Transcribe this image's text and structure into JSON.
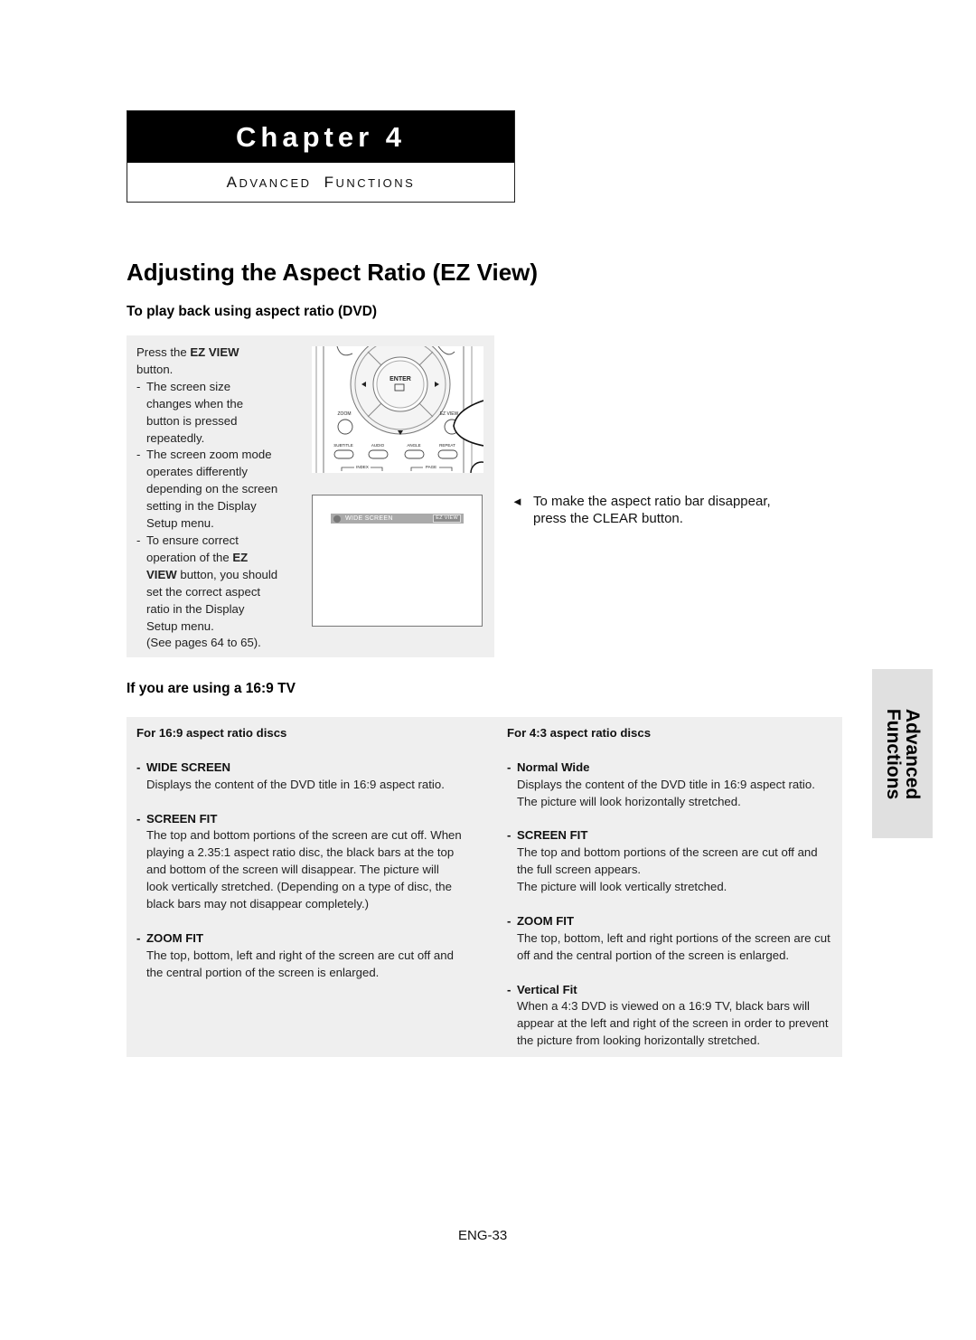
{
  "chapter": {
    "title": "Chapter 4",
    "subtitle_parts": [
      {
        "cap": "A",
        "rest": "DVANCED"
      },
      {
        "cap": "F",
        "rest": "UNCTIONS"
      }
    ]
  },
  "page_title": "Adjusting the Aspect Ratio (EZ View)",
  "section_dvd": {
    "heading": "To play back using aspect ratio (DVD)",
    "instructions": {
      "press_prefix": "Press the ",
      "press_bold": "EZ VIEW",
      "press_suffix": "button.",
      "bullets": [
        {
          "lines": [
            "The screen size",
            "changes when the",
            "button is pressed",
            "repeatedly."
          ]
        },
        {
          "lines": [
            "The screen zoom mode",
            "operates differently",
            "depending on the screen",
            "setting in the Display",
            "Setup menu."
          ]
        },
        {
          "line1_prefix": "To ensure correct",
          "line2_prefix": "operation of the ",
          "line2_bold": "EZ",
          "line3_bold": "VIEW",
          "line3_suffix": " button, you should",
          "rest": [
            "set the correct aspect",
            "ratio in the Display",
            "Setup menu.",
            "(See pages 64 to 65)."
          ]
        }
      ]
    },
    "remote": {
      "buttons": {
        "enter": "ENTER",
        "zoom": "ZOOM",
        "ez_view": "EZ VIEW",
        "subtitle": "SUBTITLE",
        "audio": "AUDIO",
        "angle": "ANGLE",
        "repeat": "REPEAT",
        "index": "INDEX",
        "page": "PAGE"
      }
    },
    "tv_screen": {
      "mode_label": "WIDE SCREEN",
      "badge": "EZ VIEW"
    },
    "note": {
      "arrow": "◄",
      "line1": "To make the aspect ratio bar disappear,",
      "line2": "press the CLEAR button."
    }
  },
  "section_169": {
    "heading": "If you are using a 16:9 TV",
    "left_column": {
      "heading": "For 16:9 aspect ratio discs",
      "items": [
        {
          "title": "WIDE SCREEN",
          "lines": [
            "Displays the content of the DVD title in 16:9 aspect ratio."
          ]
        },
        {
          "title": "SCREEN FIT",
          "lines": [
            "The top and bottom portions of the screen are cut off. When",
            "playing a 2.35:1 aspect ratio disc, the black bars at the top",
            "and bottom of the screen will disappear. The picture will",
            "look vertically stretched. (Depending on a type of disc, the",
            "black bars may not disappear completely.)"
          ]
        },
        {
          "title": "ZOOM FIT",
          "lines": [
            "The top, bottom, left and right of the screen are cut off and",
            "the central portion of the screen is enlarged."
          ]
        }
      ]
    },
    "right_column": {
      "heading": "For 4:3 aspect ratio discs",
      "items": [
        {
          "title": "Normal Wide",
          "lines": [
            "Displays the content of the DVD title in 16:9 aspect ratio.",
            "The picture will look horizontally stretched."
          ]
        },
        {
          "title": "SCREEN FIT",
          "lines": [
            "The top and bottom portions of the screen are cut off and",
            "the full screen appears.",
            "The picture will look vertically stretched."
          ]
        },
        {
          "title": "ZOOM FIT",
          "lines": [
            "The top, bottom, left and right portions of the screen are cut",
            "off and the central portion of the screen is enlarged."
          ]
        },
        {
          "title": "Vertical Fit",
          "lines": [
            "When a 4:3 DVD is viewed on a 16:9 TV, black bars will",
            "appear at the left and right of the screen in order to prevent",
            "the picture from looking horizontally stretched."
          ]
        }
      ]
    }
  },
  "side_tab": {
    "line1": "Advanced",
    "line2": "Functions"
  },
  "page_number": "ENG-33",
  "dash": "-"
}
